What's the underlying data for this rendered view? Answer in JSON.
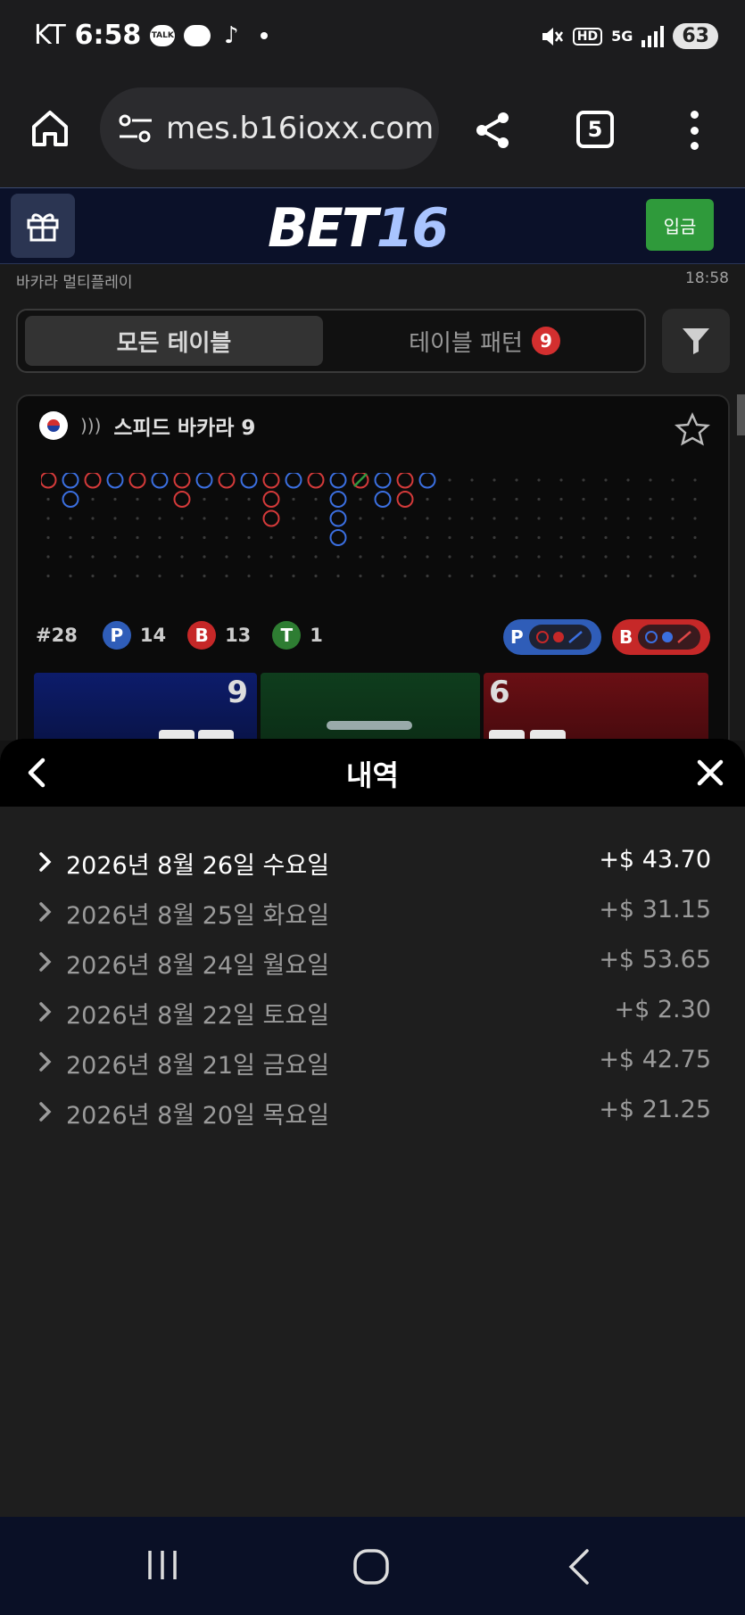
{
  "status_bar": {
    "carrier": "KT",
    "time": "6:58",
    "notif_talk": "TALK",
    "hd_label": "HD",
    "network_label": "5G",
    "battery": "63"
  },
  "browser": {
    "url": "mes.b16ioxx.com",
    "tab_count": "5"
  },
  "site": {
    "logo_text_main": "BET",
    "logo_text_num": "16",
    "deposit_label": "입금",
    "sub_title": "바카라 멀티플레이",
    "sub_time": "18:58",
    "accent_green": "#2f9a3b",
    "header_bg": "#0b1129"
  },
  "tabs": {
    "all_tables": "모든 테이블",
    "table_pattern": "테이블 패턴",
    "pattern_badge": "9"
  },
  "table_card": {
    "name": "스피드 바카라 9",
    "round": "#28",
    "player_label": "P",
    "player_count": "14",
    "banker_label": "B",
    "banker_count": "13",
    "tie_label": "T",
    "tie_count": "1",
    "predict_player_label": "P",
    "predict_banker_label": "B",
    "player_score": "9",
    "banker_score": "6",
    "player_color": "#2f5db8",
    "banker_color": "#c62828",
    "tie_color": "#2e7d32"
  },
  "history_sheet": {
    "title": "내역",
    "items": [
      {
        "date": "2026년 8월 26일 수요일",
        "amount": "+$ 43.70"
      },
      {
        "date": "2026년 8월 25일 화요일",
        "amount": "+$ 31.15"
      },
      {
        "date": "2026년 8월 24일 월요일",
        "amount": "+$ 53.65"
      },
      {
        "date": "2026년 8월 22일 토요일",
        "amount": "+$ 2.30"
      },
      {
        "date": "2026년 8월 21일 금요일",
        "amount": "+$ 42.75"
      },
      {
        "date": "2026년 8월 20일 목요일",
        "amount": "+$ 21.25"
      }
    ]
  }
}
